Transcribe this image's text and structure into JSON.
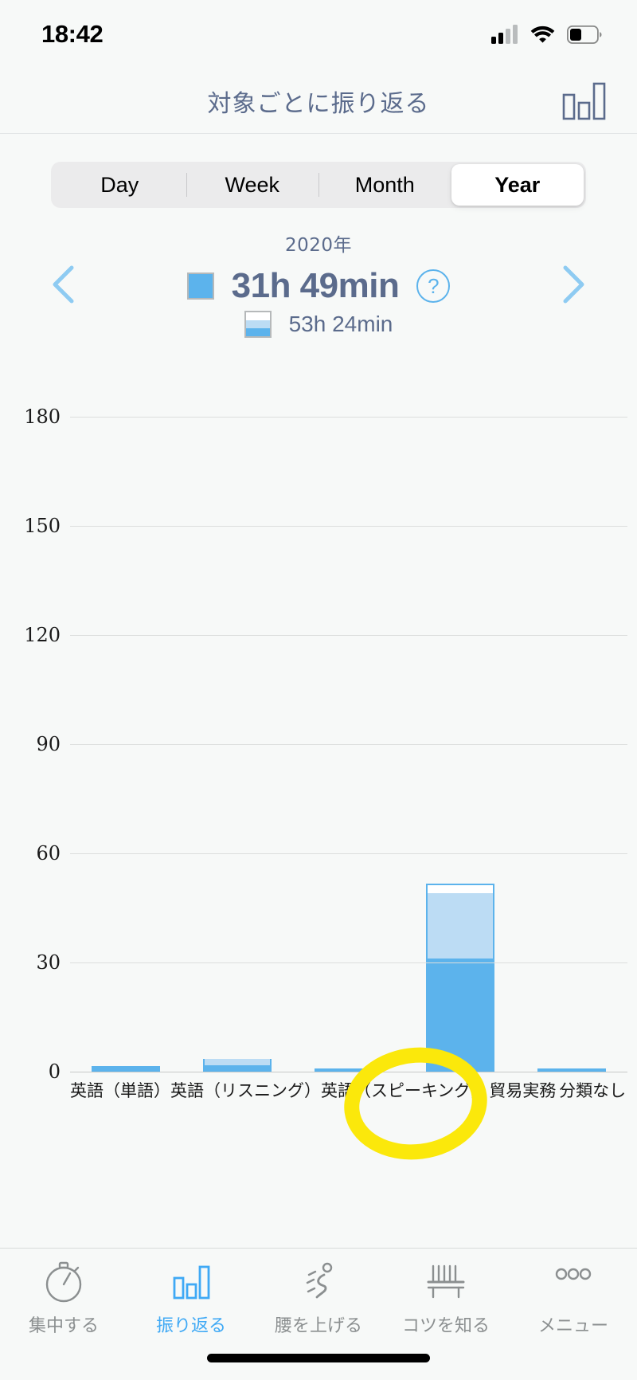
{
  "status_bar": {
    "time": "18:42",
    "icons": [
      "cellular-signal-icon",
      "wifi-icon",
      "battery-icon"
    ]
  },
  "header": {
    "title": "対象ごとに振り返る",
    "right_icon": "bar-chart-icon"
  },
  "segmented_control": {
    "options": [
      {
        "label": "Day",
        "selected": false
      },
      {
        "label": "Week",
        "selected": false
      },
      {
        "label": "Month",
        "selected": false
      },
      {
        "label": "Year",
        "selected": true
      }
    ],
    "selected": "Year"
  },
  "summary": {
    "period_label": "2020年",
    "prev_icon": "chevron-left-icon",
    "next_icon": "chevron-right-icon",
    "help_icon": "question-mark-circle-icon",
    "primary": {
      "swatch": "solid-blue-swatch",
      "value": "31h 49min"
    },
    "secondary": {
      "swatch": "stacked-swatch",
      "value": "53h 24min"
    }
  },
  "colors": {
    "accent": "#5cb3ec",
    "accent_light": "#bcdcf4",
    "title_text": "#5b6b8c",
    "grid": "#dcdedd",
    "highlight": "#fbe80b",
    "tab_active": "#3fa9f5",
    "tab_inactive": "#8b8f90"
  },
  "chart_data": {
    "type": "bar",
    "title": "",
    "xlabel": "",
    "ylabel": "",
    "ylim": [
      0,
      180
    ],
    "yticks": [
      0,
      30,
      60,
      90,
      120,
      150,
      180
    ],
    "grid": true,
    "stacked": true,
    "legend_position": "top",
    "categories": [
      "英語（単語）",
      "英語（リスニング）",
      "英語（スピーキング）",
      "貿易実務",
      "分類なし"
    ],
    "series": [
      {
        "name": "31h 49min",
        "swatch": "solid-blue",
        "color": "#5cb3ec",
        "values": [
          1.5,
          1.8,
          0.8,
          31.0,
          0.8
        ]
      },
      {
        "name": "53h 24min",
        "swatch": "light-blue",
        "color": "#bcdcf4",
        "values": [
          0,
          1.7,
          0,
          18.0,
          0
        ]
      },
      {
        "name": "remaining",
        "swatch": "white-outline",
        "color": "#ffffff",
        "values": [
          0,
          0,
          0,
          2.6,
          0
        ]
      }
    ],
    "totals": [
      1.5,
      3.5,
      0.8,
      51.6,
      0.8
    ],
    "annotation": {
      "type": "highlighter-circle",
      "target": "貿易実務",
      "color": "#fbe80b"
    }
  },
  "tab_bar": {
    "items": [
      {
        "label": "集中する",
        "icon": "stopwatch-icon",
        "active": false
      },
      {
        "label": "振り返る",
        "icon": "bar-chart-icon",
        "active": true
      },
      {
        "label": "腰を上げる",
        "icon": "running-person-icon",
        "active": false
      },
      {
        "label": "コツを知る",
        "icon": "bench-icon",
        "active": false
      },
      {
        "label": "メニュー",
        "icon": "ellipsis-icon",
        "active": false
      }
    ]
  }
}
